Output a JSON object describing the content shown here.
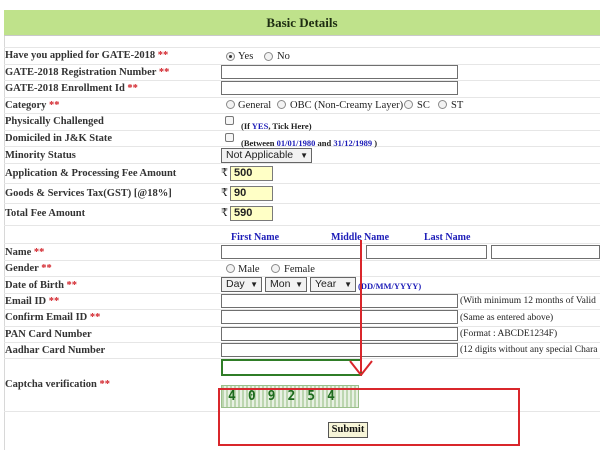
{
  "header": {
    "title": "Basic Details"
  },
  "required_mark": "**",
  "fields": {
    "applied_gate": {
      "label": "Have you applied for GATE-2018",
      "options": [
        "Yes",
        "No"
      ],
      "selected": "Yes"
    },
    "registration_number": {
      "label": "GATE-2018 Registration Number"
    },
    "enrollment_id": {
      "label": "GATE-2018 Enrollment Id"
    },
    "category": {
      "label": "Category",
      "options": [
        "General",
        "OBC (Non-Creamy Layer)",
        "SC",
        "ST"
      ]
    },
    "physically_challenged": {
      "label": "Physically Challenged",
      "note_prefix": "(If ",
      "note_yes": "YES",
      "note_suffix": ", Tick Here)"
    },
    "domiciled": {
      "label": "Domiciled in J&K State",
      "note_prefix": "(Between ",
      "date_from": "01/01/1980",
      "note_and": " and ",
      "date_to": "31/12/1989",
      "note_suffix": " )"
    },
    "minority_status": {
      "label": "Minority Status",
      "value": "Not Applicable"
    },
    "application_fee": {
      "label": "Application & Processing Fee Amount",
      "currency": "₹",
      "value": "500"
    },
    "gst": {
      "label": "Goods & Services Tax(GST) [@18%]",
      "currency": "₹",
      "value": "90"
    },
    "total_fee": {
      "label": "Total Fee Amount",
      "currency": "₹",
      "value": "590"
    },
    "name": {
      "label": "Name",
      "columns": [
        "First Name",
        "Middle Name",
        "Last Name"
      ]
    },
    "gender": {
      "label": "Gender",
      "options": [
        "Male",
        "Female"
      ]
    },
    "dob": {
      "label": "Date of Birth",
      "day": "Day",
      "month": "Mon",
      "year": "Year",
      "format_hint": "(DD/MM/YYYY)"
    },
    "email": {
      "label": "Email ID",
      "hint": "(With minimum 12 months of Valid"
    },
    "confirm_email": {
      "label": "Confirm Email ID",
      "hint": "(Same as entered above)"
    },
    "pan": {
      "label": "PAN Card Number",
      "hint": "(Format : ABCDE1234F)"
    },
    "aadhar": {
      "label": "Aadhar Card Number",
      "hint": "(12 digits without any special Chara"
    },
    "captcha": {
      "label": "Captcha verification",
      "image_text": "409254"
    }
  },
  "submit_label": "Submit",
  "colors": {
    "header_bg": "#bfe28b",
    "required": "#d2232a",
    "link_blue": "#1d1db8",
    "fee_bg": "#ffffc6",
    "annotation_red": "#d9262b",
    "captcha_border": "#2f7d27"
  }
}
